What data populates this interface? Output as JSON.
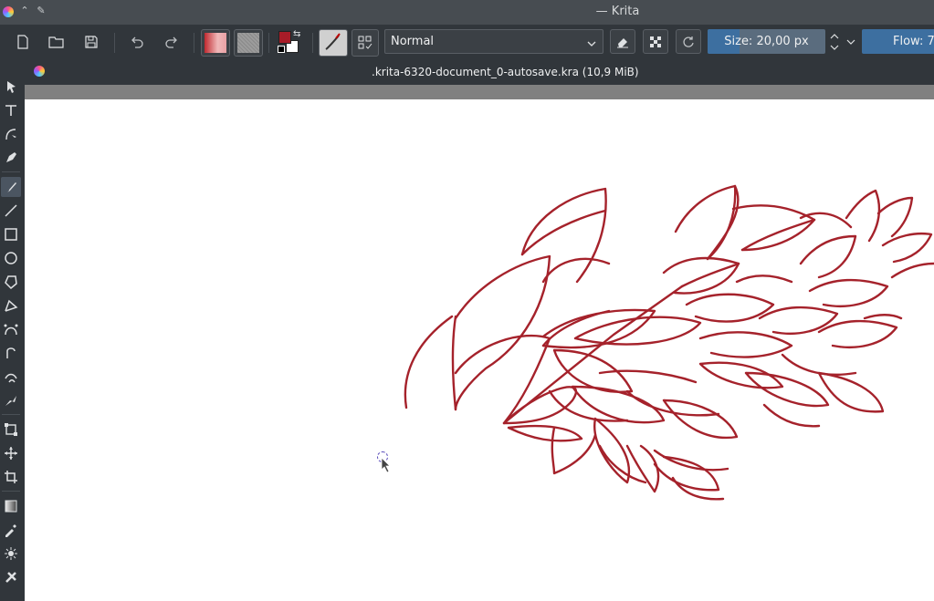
{
  "window": {
    "title": "— Krita"
  },
  "toolbar": {
    "blend_mode": "Normal",
    "size_label": "Size: 20,00 px",
    "flow_label": "Flow: 7",
    "size_fraction": 0.27,
    "foreground_color": "#a81c28",
    "background_color": "#ffffff",
    "gradient_color": "#b8262c"
  },
  "document": {
    "tab_title": ".krita-6320-document_0-autosave.kra (10,9 MiB)"
  },
  "colors": {
    "brush_stroke": "#a5222b",
    "accent": "#3d6fa0",
    "canvas": "#ffffff"
  },
  "tools": [
    "select-shapes",
    "text",
    "edit-shapes",
    "calligraphy",
    "freehand-brush",
    "line",
    "rectangle",
    "ellipse",
    "polygon",
    "polyline",
    "bezier-curve",
    "freehand-path",
    "dynamic-brush",
    "transform",
    "move",
    "crop",
    "gradient",
    "color-picker",
    "colorize-mask",
    "smart-patch"
  ]
}
